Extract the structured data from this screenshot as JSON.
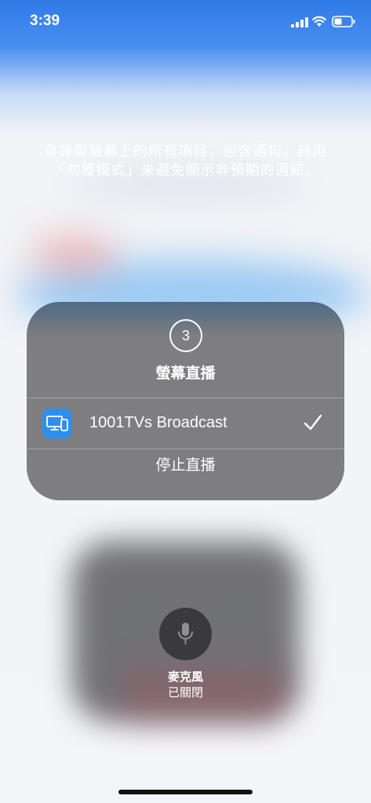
{
  "status_bar": {
    "time": "3:39",
    "icons": [
      "cellular-signal-icon",
      "wifi-icon",
      "battery-icon"
    ]
  },
  "warning": {
    "text": "會錄製螢幕上的所有項目，包含通知。啟用「勿擾模式」來避免顯示非預期的通知。"
  },
  "sheet": {
    "countdown": "3",
    "title": "螢幕直播",
    "options": [
      {
        "label": "1001TVs Broadcast",
        "icon": "broadcast-app-icon",
        "selected": true
      }
    ],
    "stop_label": "停止直播"
  },
  "microphone": {
    "label": "麥克風",
    "status": "已關閉",
    "icon": "microphone-icon"
  },
  "colors": {
    "sheet_background": "#7e7e80",
    "app_icon_blue": "#2f8ff0",
    "status_bar_blue": "#2f7ae8"
  }
}
